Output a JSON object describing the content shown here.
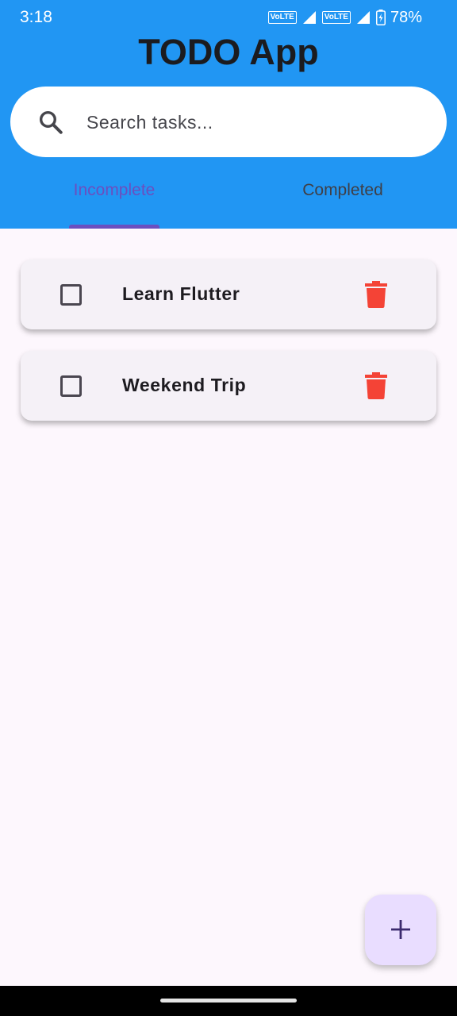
{
  "status_bar": {
    "time": "3:18",
    "volte_1": "VoLTE",
    "volte_2": "VoLTE",
    "battery": "78%",
    "icons": [
      "signal-icon",
      "signal-icon",
      "battery-charging-icon"
    ]
  },
  "app": {
    "title": "TODO App"
  },
  "search": {
    "placeholder": "Search tasks...",
    "value": "",
    "icon": "search-icon"
  },
  "tabs": [
    {
      "label": "Incomplete",
      "selected": true
    },
    {
      "label": "Completed",
      "selected": false
    }
  ],
  "tasks": [
    {
      "title": "Learn Flutter",
      "done": false
    },
    {
      "title": "Weekend Trip",
      "done": false
    }
  ],
  "fab": {
    "icon": "add-icon"
  },
  "colors": {
    "app_bar": "#2196f3",
    "accent": "#6b4fbf",
    "delete": "#f44336",
    "background": "#fdf7fd",
    "card": "#f5f1f7",
    "fab": "#e9ddff"
  }
}
